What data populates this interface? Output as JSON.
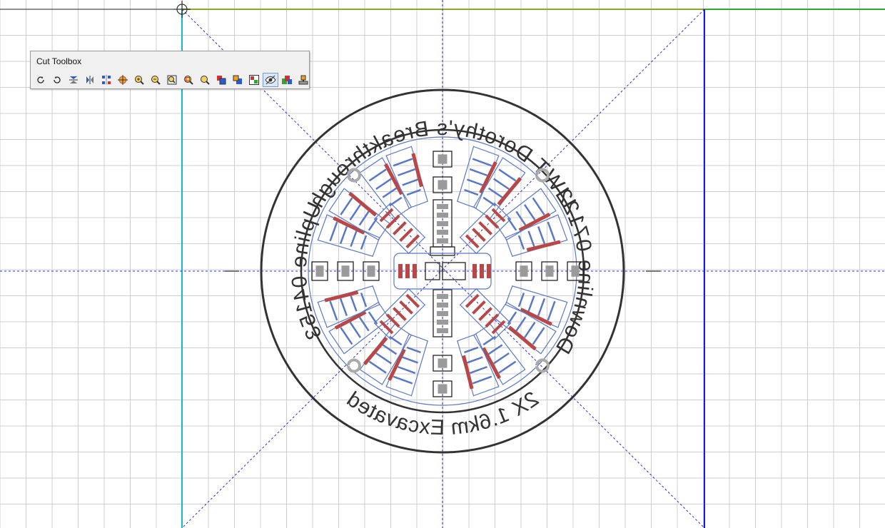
{
  "canvas": {
    "colors": {
      "grid": "#cfcfcf",
      "guide": "#2b2bd6",
      "material_edge_blue": "#1a1ad8",
      "material_edge_cyan": "#10b8c8",
      "top_green": "#2ea82e",
      "engrave": "#333333",
      "cut_blue": "#5a78c8",
      "fill_red": "#b84848",
      "fill_gray": "#9a9a9a"
    },
    "engraved_text": {
      "top": "LIWT Dorothy's Breakthrough",
      "right": "Downline 07122",
      "bottom": "2X 1.6km Excavated",
      "left": "Upline 04153"
    }
  },
  "toolbox": {
    "title": "Cut Toolbox",
    "buttons": [
      {
        "icon": "rotate-ccw-icon",
        "active": false
      },
      {
        "icon": "rotate-cw-icon",
        "active": false
      },
      {
        "icon": "mirror-vertical-icon",
        "active": false
      },
      {
        "icon": "mirror-horizontal-icon",
        "active": false
      },
      {
        "icon": "array-icon",
        "active": false
      },
      {
        "icon": "center-target-icon",
        "active": false
      },
      {
        "icon": "zoom-in-icon",
        "active": false
      },
      {
        "icon": "zoom-out-icon",
        "active": false
      },
      {
        "icon": "zoom-page-icon",
        "active": false
      },
      {
        "icon": "zoom-selection-icon",
        "active": false
      },
      {
        "icon": "zoom-fit-icon",
        "active": false
      },
      {
        "icon": "bring-front-icon",
        "active": false
      },
      {
        "icon": "send-back-icon",
        "active": false
      },
      {
        "icon": "group-icon",
        "active": false
      },
      {
        "icon": "preview-eye-icon",
        "active": true
      },
      {
        "icon": "color-layers-icon",
        "active": false
      },
      {
        "icon": "laser-stamp-icon",
        "active": false
      }
    ]
  }
}
